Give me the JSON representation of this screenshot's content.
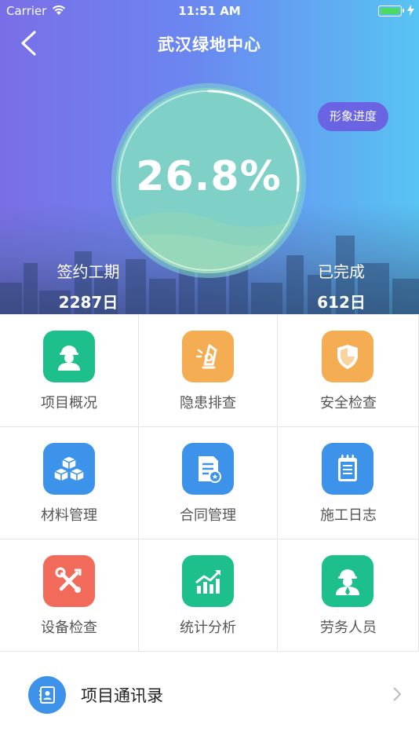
{
  "status_bar": {
    "carrier": "Carrier",
    "time": "11:51 AM"
  },
  "header": {
    "title": "武汉绿地中心",
    "image_progress_button": "形象进度"
  },
  "progress": {
    "percent_text": "26.8%",
    "percent_value": 26.8
  },
  "stats": {
    "contract_period": {
      "label": "签约工期",
      "value": "2287日"
    },
    "completed": {
      "label": "已完成",
      "value": "612日"
    }
  },
  "menu": [
    {
      "label": "项目概况",
      "icon": "worker-icon",
      "color": "#1dbf8c"
    },
    {
      "label": "隐患排查",
      "icon": "hazard-icon",
      "color": "#f4ad52"
    },
    {
      "label": "安全检查",
      "icon": "shield-icon",
      "color": "#f4ad52"
    },
    {
      "label": "材料管理",
      "icon": "boxes-icon",
      "color": "#3d93e9"
    },
    {
      "label": "合同管理",
      "icon": "contract-icon",
      "color": "#3d93e9"
    },
    {
      "label": "施工日志",
      "icon": "notebook-icon",
      "color": "#3d93e9"
    },
    {
      "label": "设备检查",
      "icon": "tools-icon",
      "color": "#f16a5a"
    },
    {
      "label": "统计分析",
      "icon": "chart-icon",
      "color": "#1dbf8c"
    },
    {
      "label": "劳务人员",
      "icon": "laborer-icon",
      "color": "#1dbf8c"
    }
  ],
  "contacts": {
    "label": "项目通讯录",
    "icon": "address-book-icon"
  }
}
